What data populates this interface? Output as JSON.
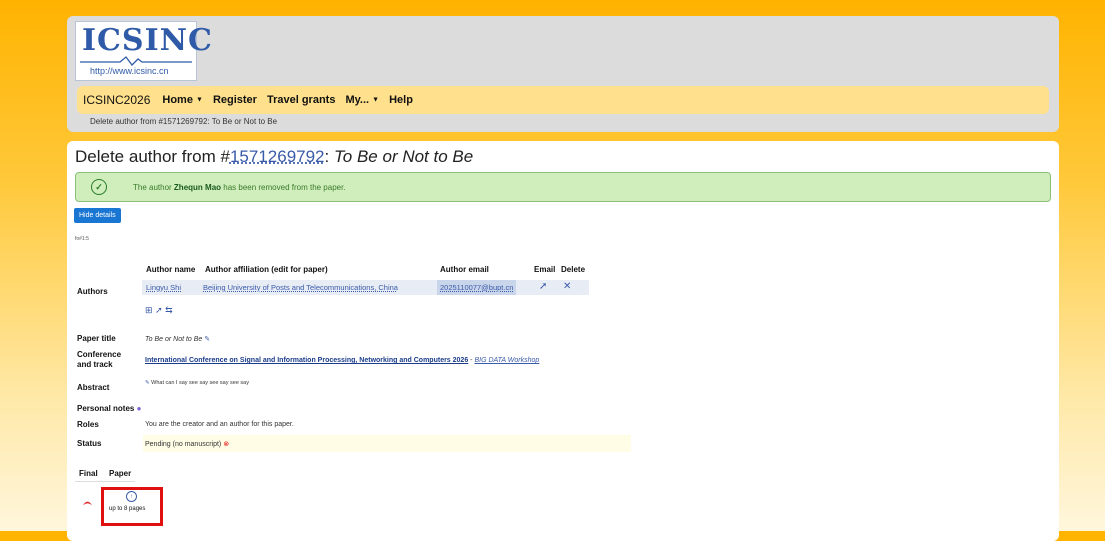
{
  "logo": {
    "title": "ICSINC",
    "url": "http://www.icsinc.cn"
  },
  "nav": {
    "brand": "ICSINC2026",
    "items": [
      {
        "label": "Home",
        "caret": true
      },
      {
        "label": "Register",
        "caret": false
      },
      {
        "label": "Travel grants",
        "caret": false
      },
      {
        "label": "My...",
        "caret": true
      },
      {
        "label": "Help",
        "caret": false
      }
    ]
  },
  "breadcrumb": "Delete author from #1571269792: To Be or Not to Be",
  "page": {
    "title_prefix": "Delete author from #",
    "paper_id": "1571269792",
    "title_sep": ": ",
    "paper_title": "To Be or Not to Be"
  },
  "alert": {
    "pre": "The author ",
    "name": "Zhequn Mao",
    "post": " has been removed from the paper."
  },
  "hide_details_label": "Hide details",
  "fold_label": "fo#1:5",
  "authors": {
    "label": "Authors",
    "headers": {
      "name": "Author name",
      "affiliation": "Author affiliation (edit for paper)",
      "email": "Author email",
      "email_action": "Email",
      "delete": "Delete"
    },
    "rows": [
      {
        "name": "Lingyu Shi",
        "affiliation": "Beijing University of Posts and Telecommunications, China",
        "email": "2025110077@bupt.cn"
      }
    ]
  },
  "paper_title": {
    "label": "Paper title",
    "value": "To Be or Not to Be"
  },
  "conference": {
    "label_line1": "Conference",
    "label_line2": "and track",
    "name": "International Conference on Signal and Information Processing, Networking and Computers 2026",
    "sep": " - ",
    "track": "BIG DATA Workshop"
  },
  "abstract": {
    "label": "Abstract",
    "value": "What can I say see say see say see say"
  },
  "personal_notes": {
    "label": "Personal notes"
  },
  "roles": {
    "label": "Roles",
    "value": "You are the creator and an author for this paper."
  },
  "status": {
    "label": "Status",
    "value": "Pending (no manuscript)"
  },
  "final_table": {
    "headers": [
      "Final",
      "Paper"
    ],
    "upload_text": "up to 8 pages"
  },
  "colors": {
    "accent_blue": "#1976d2",
    "success_bg": "#cfeebc",
    "highlight_red": "#e01010",
    "nav_bg": "#ffe08c"
  }
}
